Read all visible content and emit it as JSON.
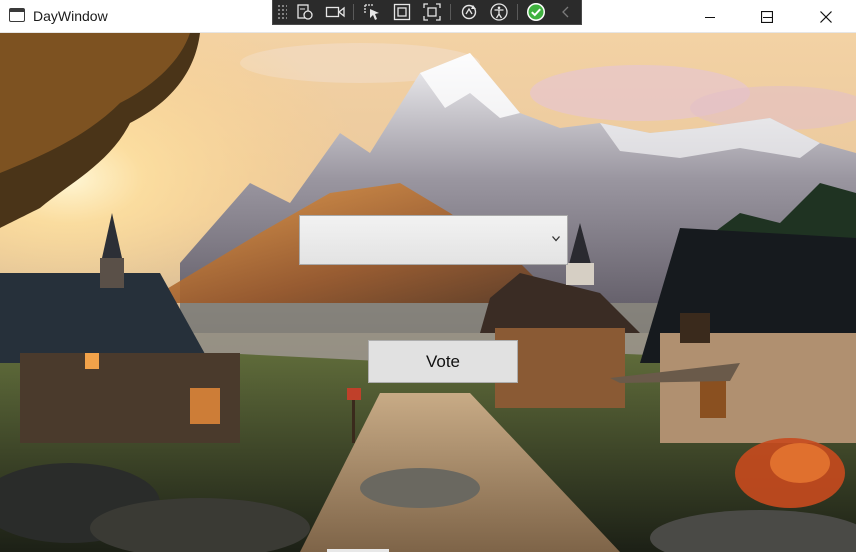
{
  "window": {
    "title": "DayWindow"
  },
  "debug_toolbar": {
    "buttons": [
      "live-visual-tree-icon",
      "video-camera-icon",
      "select-element-icon",
      "display-layout-adorners-icon",
      "track-focused-element-icon",
      "hot-reload-icon",
      "accessibility-icon",
      "binding-failures-check-icon",
      "collapse-chevron-icon"
    ],
    "accent": "#3fb23f"
  },
  "combo": {
    "value": ""
  },
  "vote_button": {
    "label": "Vote"
  },
  "caption_buttons": [
    "minimize-icon",
    "maximize-icon",
    "close-icon"
  ]
}
